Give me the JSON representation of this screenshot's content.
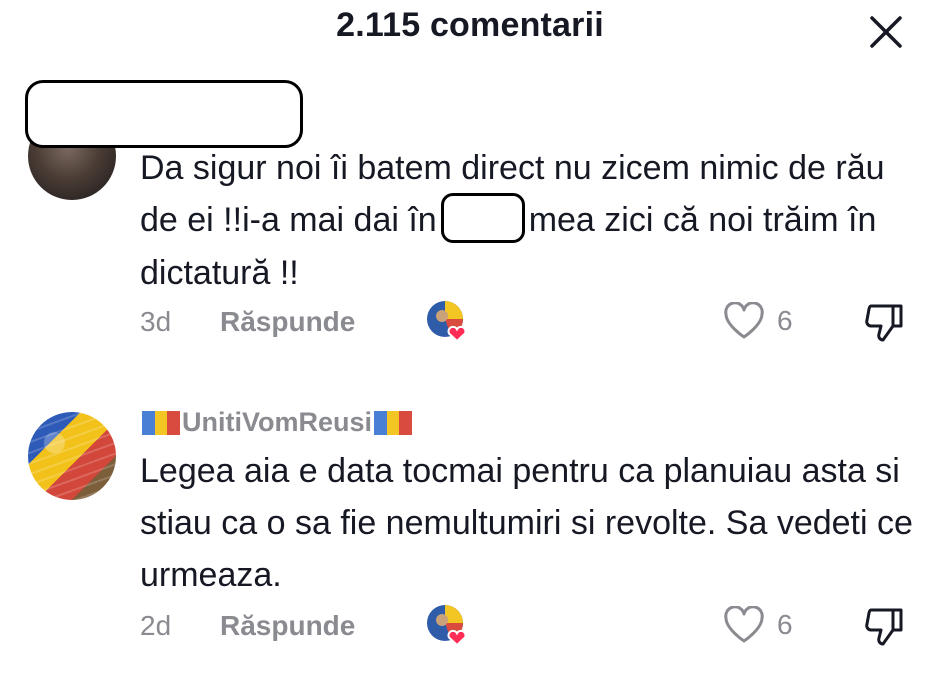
{
  "header": {
    "title": "2.115 comentarii"
  },
  "comments": [
    {
      "text_part1": "Da sigur noi îi batem direct nu zicem nimic de rău de ei !!i-a mai dai în",
      "text_part2": "mea zici că noi trăim în dictatură !!",
      "time": "3d",
      "reply_label": "Răspunde",
      "likes": "6"
    },
    {
      "username": "UnitiVomReusi",
      "text": "Legea aia e data tocmai pentru ca planuiau asta si stiau ca o sa fie nemultumiri si revolte. Sa vedeti ce urmeaza.",
      "time": "2d",
      "reply_label": "Răspunde",
      "likes": "6"
    }
  ],
  "colors": {
    "text": "#161823",
    "muted": "#8a8b91",
    "heart": "#ff2c55",
    "flag_blue": "#4a7fd6",
    "flag_yellow": "#f3c623",
    "flag_red": "#d94b3f"
  },
  "icons": {
    "close": "close-icon",
    "like": "heart-outline-icon",
    "dislike": "thumbs-down-icon",
    "creator_reaction": "avatar-heart-icon"
  }
}
